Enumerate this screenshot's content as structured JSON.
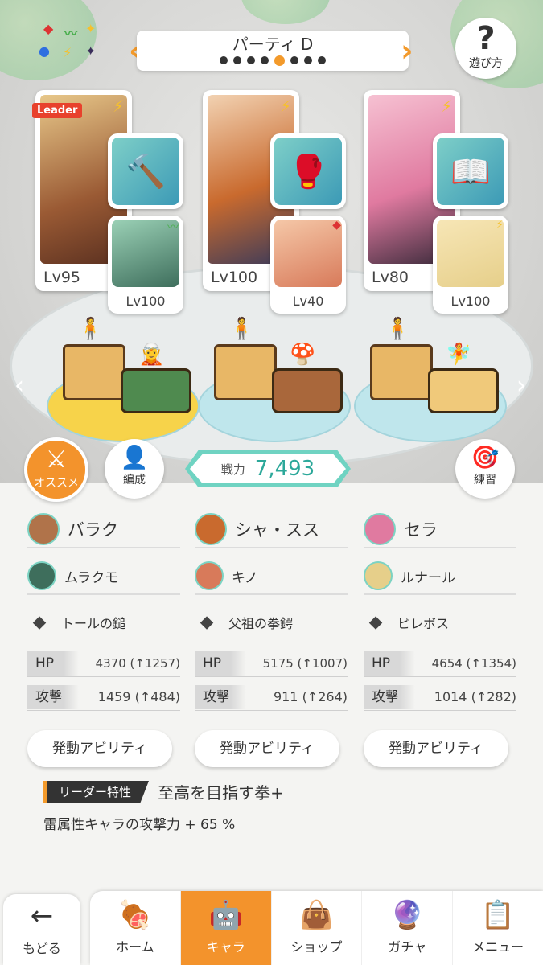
{
  "party": {
    "name": "パーティ D",
    "page_count": 8,
    "active_index": 4
  },
  "help": {
    "label": "遊び方"
  },
  "attributes": [
    "◆",
    "〰",
    "✦",
    "●",
    "⚡",
    "✦"
  ],
  "members": [
    {
      "lv": "Lv95",
      "leader": "Leader",
      "attr": "⚡",
      "color": "#9a5a34",
      "weapon_icon": "🔨",
      "sub": {
        "lv": "Lv100",
        "mark": "〰",
        "mark_color": "#4caf50",
        "color": "#3e6e5c"
      }
    },
    {
      "lv": "Lv100",
      "attr": "⚡",
      "color": "#c96a2e",
      "weapon_icon": "🥊",
      "sub": {
        "lv": "Lv40",
        "mark": "◆",
        "mark_color": "#d33",
        "color": "#d87a5a"
      }
    },
    {
      "lv": "Lv80",
      "attr": "⚡",
      "color": "#e07aa0",
      "weapon_icon": "📖",
      "sub": {
        "lv": "Lv100",
        "mark": "⚡",
        "mark_color": "#f6c02c",
        "color": "#e6cf8a"
      }
    }
  ],
  "power": {
    "label": "戦力",
    "value": "7,493"
  },
  "buttons": {
    "recommend": "オススメ",
    "formation": "編成",
    "practice": "練習"
  },
  "columns": [
    {
      "main": "バラク",
      "sub": "ムラクモ",
      "weapon": "トールの鎚",
      "hp_label": "HP",
      "hp": "4370 (↑1257)",
      "atk_label": "攻撃",
      "atk": "1459 (↑484)",
      "ability": "発動アビリティ"
    },
    {
      "main": "シャ・スス",
      "sub": "キノ",
      "weapon": "父祖の拳鍔",
      "hp_label": "HP",
      "hp": "5175 (↑1007)",
      "atk_label": "攻撃",
      "atk": "911 (↑264)",
      "ability": "発動アビリティ"
    },
    {
      "main": "セラ",
      "sub": "ルナール",
      "weapon": "ピレボス",
      "hp_label": "HP",
      "hp": "4654 (↑1354)",
      "atk_label": "攻撃",
      "atk": "1014 (↑282)",
      "ability": "発動アビリティ"
    }
  ],
  "leader_skill": {
    "tag": "リーダー特性",
    "title": "至高を目指す拳+",
    "desc": "雷属性キャラの攻撃力 + 65 %"
  },
  "nav": {
    "back": "もどる",
    "tabs": [
      {
        "label": "ホーム",
        "icon": "home-icon"
      },
      {
        "label": "キャラ",
        "icon": "chara-icon"
      },
      {
        "label": "ショップ",
        "icon": "shop-icon"
      },
      {
        "label": "ガチャ",
        "icon": "gacha-icon"
      },
      {
        "label": "メニュー",
        "icon": "menu-icon"
      }
    ],
    "active_tab": 1
  }
}
